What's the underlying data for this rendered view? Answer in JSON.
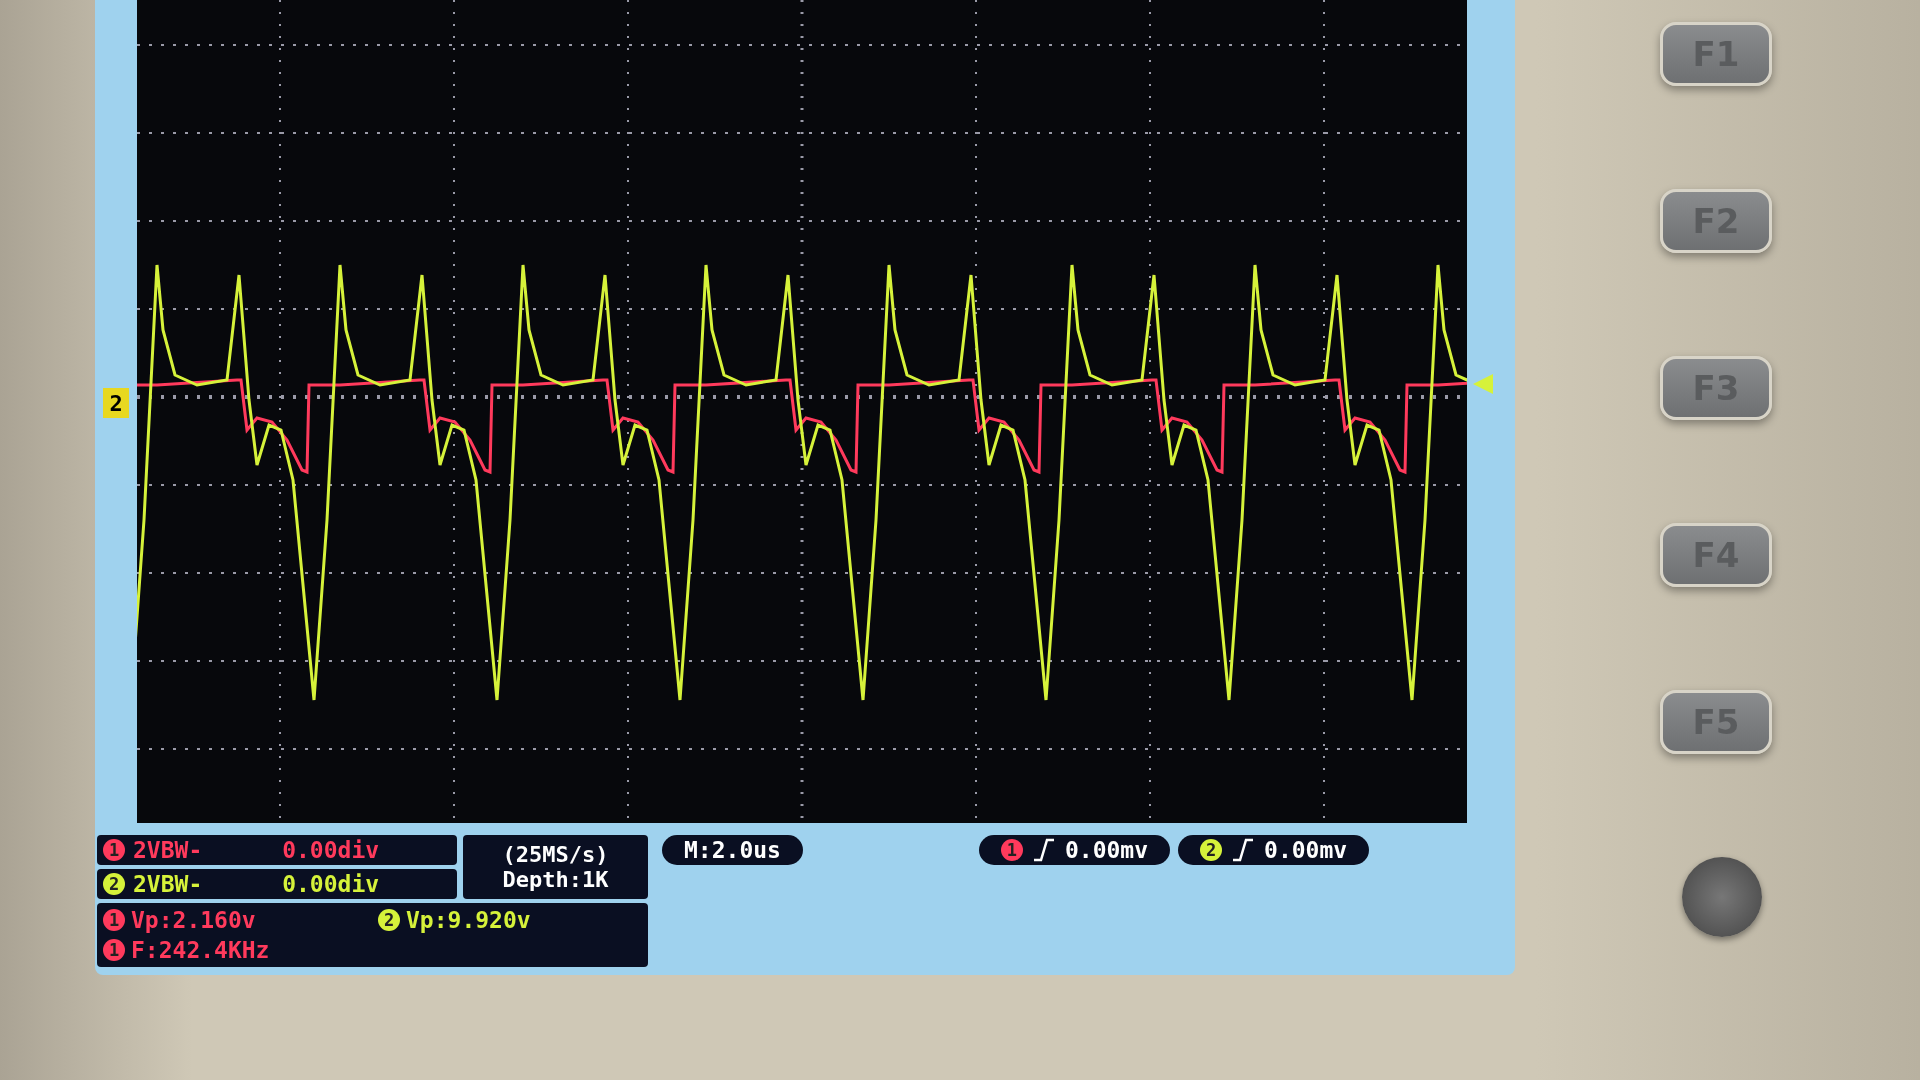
{
  "screen": {
    "channel_marker": "2"
  },
  "channels": [
    {
      "channel": "1",
      "color": "#ff3a5c",
      "coupling": "2VBW-",
      "offset": "0.00div",
      "trigger_channel": "1",
      "trigger": "0.00mv"
    },
    {
      "channel": "2",
      "color": "#d6f23a",
      "coupling": "2VBW-",
      "offset": "0.00div",
      "trigger_channel": "2",
      "trigger": "0.00mv"
    }
  ],
  "acquisition": {
    "sample_rate": "(25MS/s)",
    "depth": "Depth:1K"
  },
  "timebase": "M:2.0us",
  "measurements": [
    {
      "channel": "1",
      "color": "#ff3a5c",
      "text": "Vp:2.160v"
    },
    {
      "channel": "2",
      "color": "#d6f23a",
      "text": "Vp:9.920v"
    },
    {
      "channel": "1",
      "color": "#ff3a5c",
      "text": "F:242.4KHz"
    }
  ],
  "buttons": [
    "F1",
    "F2",
    "F3",
    "F4",
    "F5"
  ]
}
